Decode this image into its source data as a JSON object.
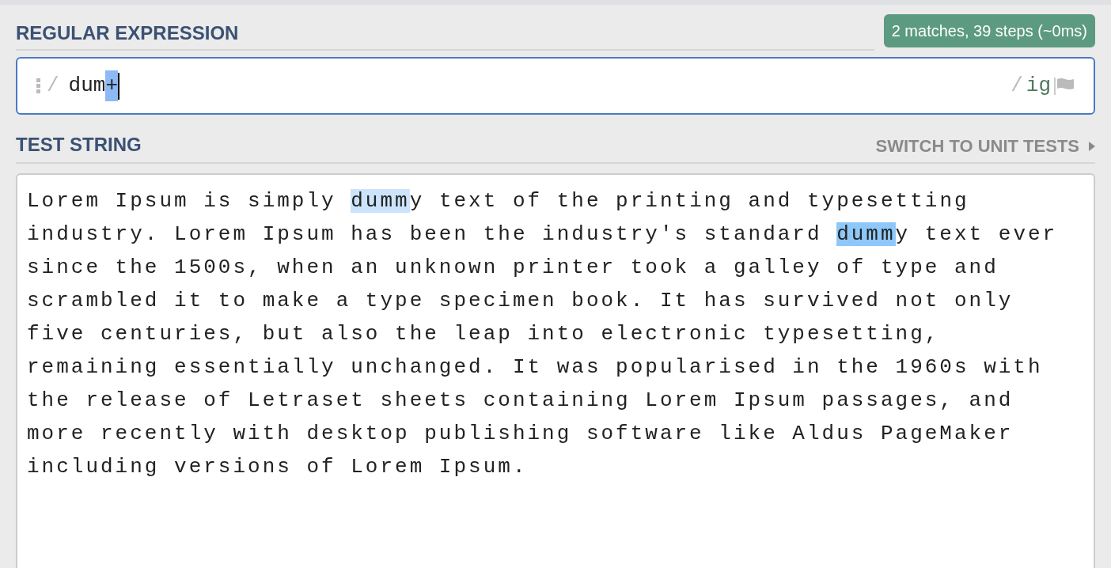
{
  "regex_section": {
    "heading": "REGULAR EXPRESSION",
    "match_info": "2 matches, 39 steps (~0ms)"
  },
  "regex_field": {
    "open_delimiter": "/",
    "parts": [
      {
        "text": "dum",
        "selected": false
      },
      {
        "text": "+",
        "selected": true
      }
    ],
    "close_delimiter": "/",
    "flags": "ig"
  },
  "test_section": {
    "heading": "TEST STRING",
    "switch_link": "SWITCH TO UNIT TESTS"
  },
  "test_string": [
    {
      "segments": [
        {
          "text": "Lorem Ipsum is simply "
        },
        {
          "text": "dumm",
          "color": "#cce4fb"
        },
        {
          "text": "y text of the printing and typesetting"
        }
      ]
    },
    {
      "segments": [
        {
          "text": "industry. Lorem Ipsum has been the industry's standard "
        },
        {
          "text": "dumm",
          "color": "#8ec8fa"
        },
        {
          "text": "y text ever"
        }
      ]
    },
    {
      "segments": [
        {
          "text": "since the 1500s, when an unknown printer took a galley of type and"
        }
      ]
    },
    {
      "segments": [
        {
          "text": "scrambled it to make a type specimen book. It has survived not only"
        }
      ]
    },
    {
      "segments": [
        {
          "text": "five centuries, but also the leap into electronic typesetting,"
        }
      ]
    },
    {
      "segments": [
        {
          "text": "remaining essentially unchanged. It was popularised in the 1960s with"
        }
      ]
    },
    {
      "segments": [
        {
          "text": "the release of Letraset sheets containing Lorem Ipsum passages, and"
        }
      ]
    },
    {
      "segments": [
        {
          "text": "more recently with desktop publishing software like Aldus PageMaker"
        }
      ]
    },
    {
      "segments": [
        {
          "text": "including versions of Lorem Ipsum."
        }
      ]
    }
  ]
}
